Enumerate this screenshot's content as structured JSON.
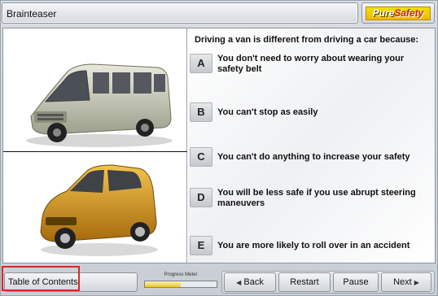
{
  "header": {
    "title": "Brainteaser",
    "logo_part1": "Pure",
    "logo_part2": "Safety"
  },
  "quiz": {
    "question": "Driving a van is different from driving a car because:",
    "answers": [
      {
        "letter": "A",
        "text": "You don't need to worry about wearing your safety belt"
      },
      {
        "letter": "B",
        "text": "You can't stop as easily"
      },
      {
        "letter": "C",
        "text": "You can't do anything to increase your safety"
      },
      {
        "letter": "D",
        "text": "You will be less safe if you use abrupt steering maneuvers"
      },
      {
        "letter": "E",
        "text": "You are more likely to roll over in an accident"
      }
    ]
  },
  "footer": {
    "toc_label": "Table of Contents",
    "progress_label": "Progress Meter",
    "progress_fraction": 0.5,
    "back_label": "Back",
    "restart_label": "Restart",
    "pause_label": "Pause",
    "next_label": "Next"
  },
  "icons": {
    "back": "left-arrow-icon",
    "next": "right-arrow-icon"
  },
  "colors": {
    "highlight": "#d6282b",
    "logo_yellow": "#f3d000",
    "van_body": "#c9cbb8",
    "car_body": "#d79a1f"
  }
}
